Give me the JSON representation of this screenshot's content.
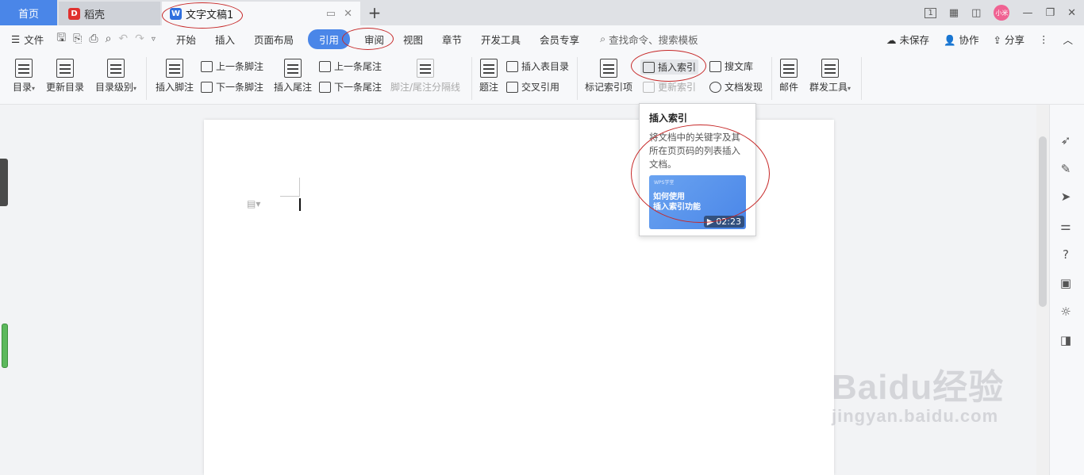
{
  "tabbar": {
    "home": "首页",
    "daoke": "稻壳",
    "doc": "文字文稿1",
    "add": "+",
    "page_indicator": "1",
    "avatar": "小米"
  },
  "menubar": {
    "file": "文件",
    "menus": [
      "开始",
      "插入",
      "页面布局",
      "引用",
      "审阅",
      "视图",
      "章节",
      "开发工具",
      "会员专享"
    ],
    "active_menu": "引用",
    "search": "查找命令、搜索模板",
    "unsaved": "未保存",
    "collab": "协作",
    "share": "分享"
  },
  "ribbon": {
    "toc": "目录",
    "update_toc": "更新目录",
    "toc_level": "目录级别",
    "insert_footnote": "插入脚注",
    "prev_footnote": "上一条脚注",
    "next_footnote": "下一条脚注",
    "insert_endnote": "插入尾注",
    "prev_endnote": "上一条尾注",
    "next_endnote": "下一条尾注",
    "separator": "脚注/尾注分隔线",
    "caption": "题注",
    "insert_table_toc": "插入表目录",
    "cross_ref": "交叉引用",
    "mark_index": "标记索引项",
    "insert_index": "插入索引",
    "update_index": "更新索引",
    "search_lib": "搜文库",
    "doc_discover": "文档发现",
    "mail": "邮件",
    "mass_tool": "群发工具"
  },
  "tooltip": {
    "title": "插入索引",
    "desc": "将文档中的关键字及其所在页页码的列表插入文档。",
    "video_brand": "WPS学堂",
    "video_line1": "如何使用",
    "video_line2": "插入索引功能",
    "duration": "02:23"
  },
  "watermark": {
    "brand": "Baidu经验",
    "url": "jingyan.baidu.com"
  },
  "colors": {
    "accent": "#4a86e8",
    "annotation": "#c62828"
  }
}
